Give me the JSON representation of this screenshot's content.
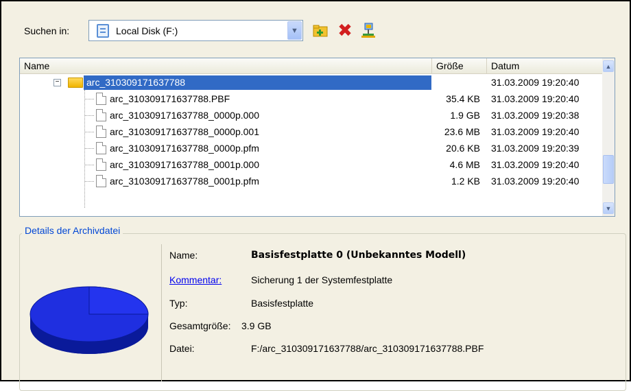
{
  "toolbar": {
    "search_label": "Suchen in:",
    "drive_selected": "Local Disk (F:)"
  },
  "columns": {
    "name": "Name",
    "size": "Größe",
    "date": "Datum"
  },
  "folder": {
    "name": "arc_310309171637788",
    "date": "31.03.2009 19:20:40"
  },
  "files": [
    {
      "name": "arc_310309171637788.PBF",
      "size": "35.4 KB",
      "date": "31.03.2009 19:20:40"
    },
    {
      "name": "arc_310309171637788_0000p.000",
      "size": "1.9 GB",
      "date": "31.03.2009 19:20:38"
    },
    {
      "name": "arc_310309171637788_0000p.001",
      "size": "23.6 MB",
      "date": "31.03.2009 19:20:40"
    },
    {
      "name": "arc_310309171637788_0000p.pfm",
      "size": "20.6 KB",
      "date": "31.03.2009 19:20:39"
    },
    {
      "name": "arc_310309171637788_0001p.000",
      "size": "4.6 MB",
      "date": "31.03.2009 19:20:40"
    },
    {
      "name": "arc_310309171637788_0001p.pfm",
      "size": "1.2 KB",
      "date": "31.03.2009 19:20:40"
    }
  ],
  "details": {
    "title": "Details der Archivdatei",
    "name_label": "Name:",
    "name_value": "Basisfestplatte 0 (Unbekanntes Modell)",
    "comment_label": "Kommentar:",
    "comment_value": "Sicherung 1 der Systemfestplatte",
    "type_label": "Typ:",
    "type_value": "Basisfestplatte",
    "size_label": "Gesamtgröße:",
    "size_value": "3.9 GB",
    "file_label": "Datei:",
    "file_value": "F:/arc_310309171637788/arc_310309171637788.PBF"
  },
  "colors": {
    "selection": "#316ac5",
    "link": "#0046d5",
    "pie": "#1f2fe0"
  },
  "icons": {
    "new_folder": "new-folder-icon",
    "delete": "delete-icon",
    "network": "network-icon"
  }
}
